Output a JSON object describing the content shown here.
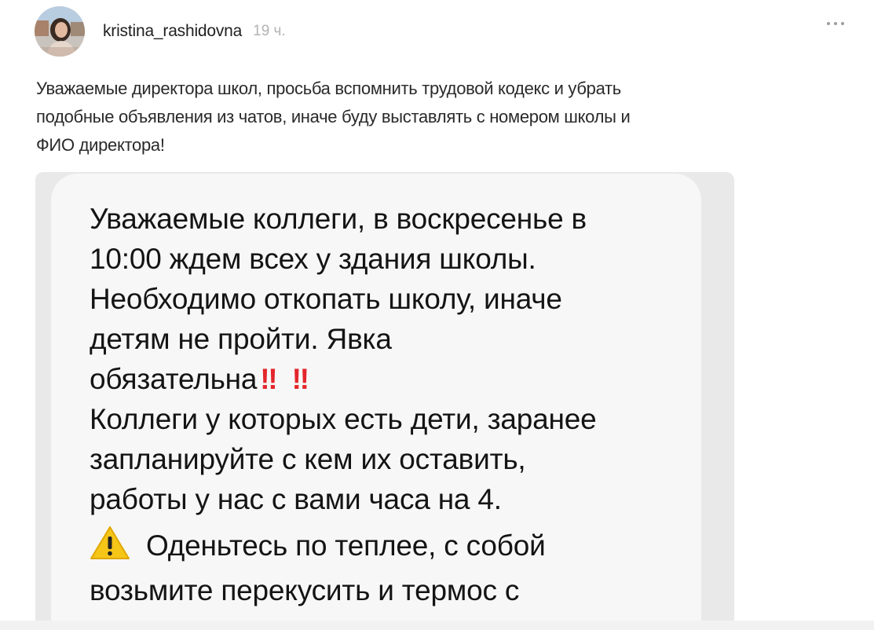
{
  "post": {
    "author": "kristina_rashidovna",
    "time": "19 ч.",
    "text_lines": [
      "Уважаемые директора школ, просьба вспомнить трудовой кодекс и убрать",
      "подобные объявления из чатов, иначе буду выставлять с номером школы и",
      "ФИО директора!"
    ]
  },
  "message": {
    "lines": [
      "Уважаемые коллеги, в воскресенье в",
      "10:00 ждем всех у здания школы.",
      "Необходимо откопать школу, иначе",
      "детям не пройти. Явка",
      "обязательна",
      "Коллеги у которых есть дети, заранее",
      "запланируйте с кем их оставить,",
      "работы у нас с вами часа на 4.",
      "Оденьтесь по теплее, с собой",
      "возьмите перекусить и термос с"
    ],
    "emoji_1": "‼",
    "emoji_2": "‼"
  },
  "icons": {
    "more": "more-dots-icon",
    "warning": "warning-icon",
    "exclamation": "double-exclamation-icon"
  },
  "colors": {
    "exclamation": "#e3262b",
    "warning": "#f5c518",
    "time": "#b3b3b3"
  }
}
